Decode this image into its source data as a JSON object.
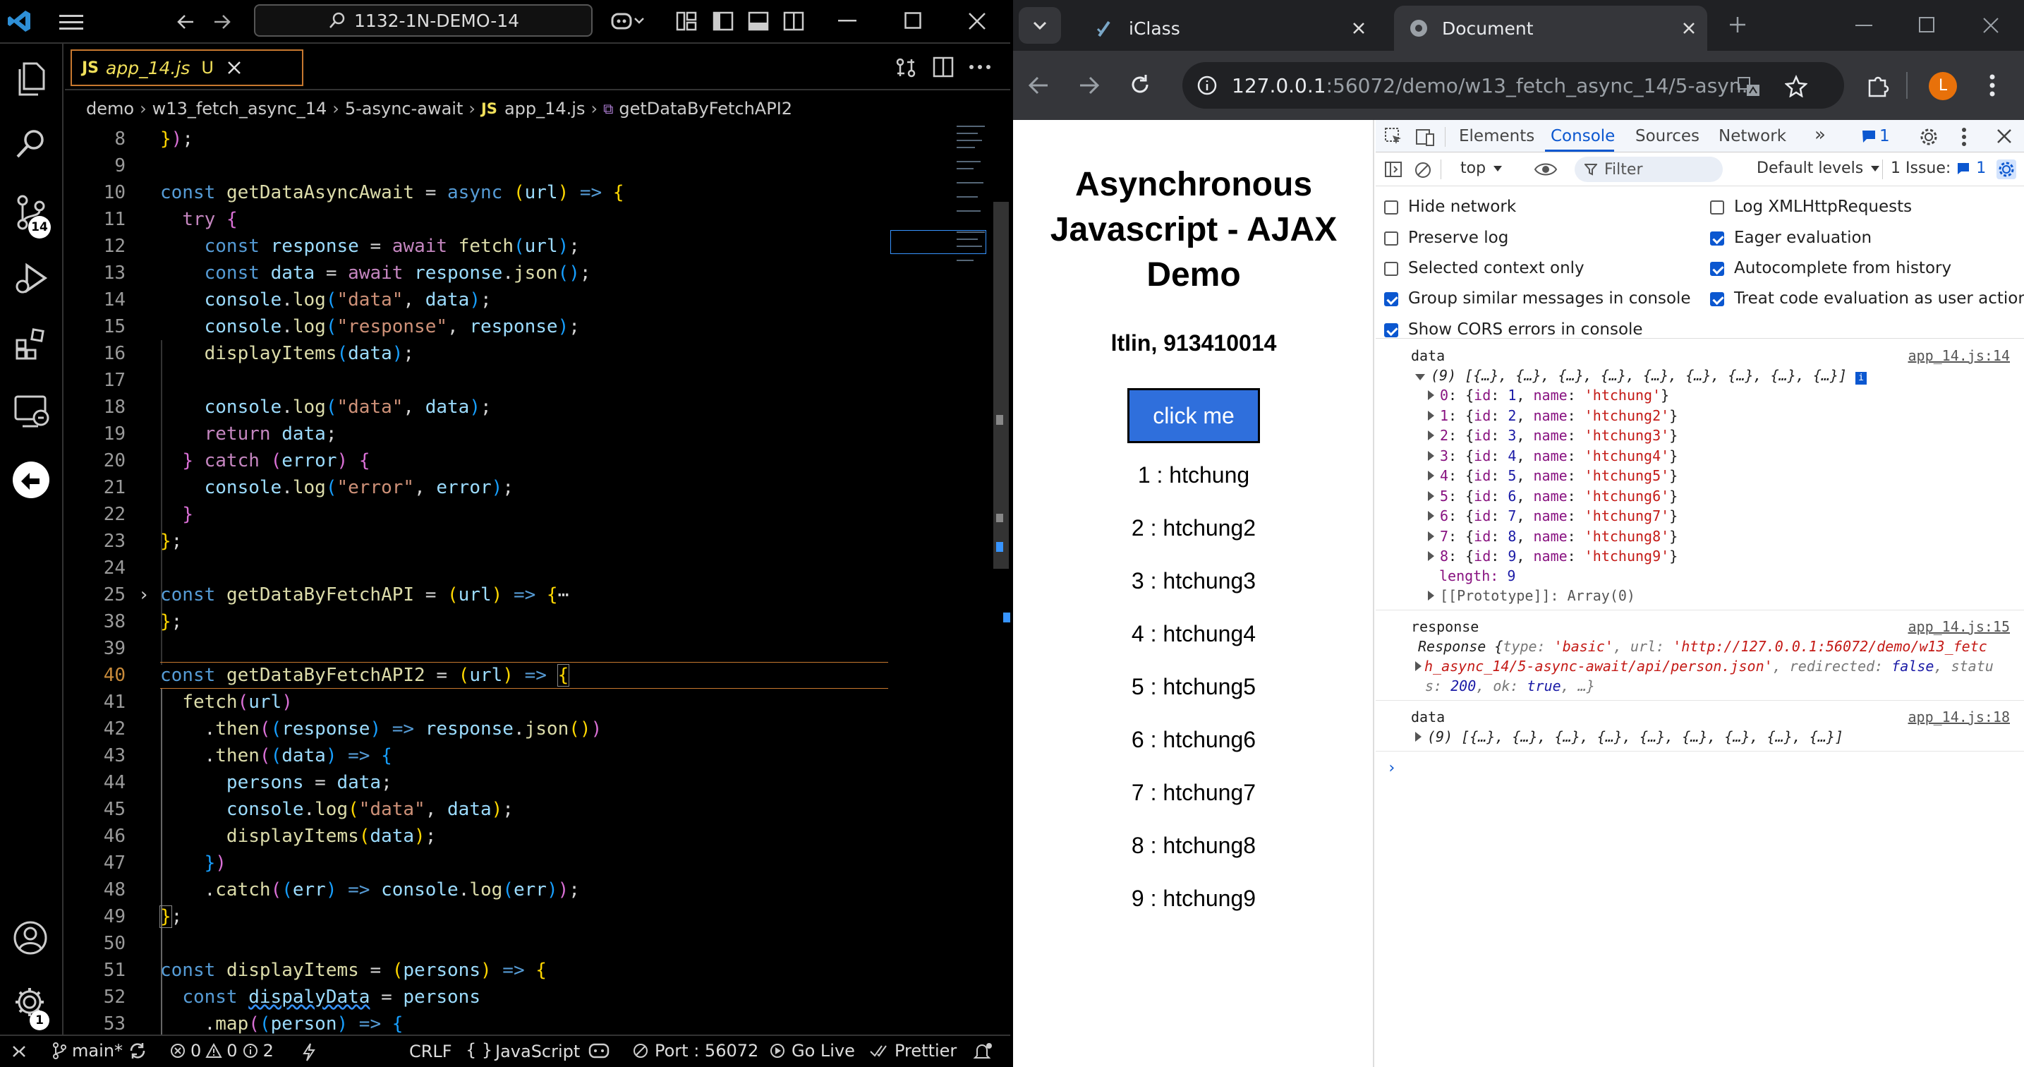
{
  "vscode": {
    "search_text": "1132-1N-DEMO-14",
    "tab": {
      "lang": "JS",
      "filename": "app_14.js",
      "status": "U"
    },
    "breadcrumb": [
      "demo",
      "w13_fetch_async_14",
      "5-async-await",
      "app_14.js",
      "getDataByFetchAPI2"
    ],
    "breadcrumb_js": "JS",
    "badge_scm": "14",
    "badge_settings": "1",
    "lines": [
      "8",
      "9",
      "10",
      "11",
      "12",
      "13",
      "14",
      "15",
      "16",
      "17",
      "18",
      "19",
      "20",
      "21",
      "22",
      "23",
      "24",
      "25",
      "38",
      "39",
      "40",
      "41",
      "42",
      "43",
      "44",
      "45",
      "46",
      "47",
      "48",
      "49",
      "50",
      "51",
      "52",
      "53"
    ],
    "status": {
      "branch": "main*",
      "errors": "0",
      "warnings": "0",
      "infos": "2",
      "eol": "CRLF",
      "lang": "JavaScript",
      "port": "Port : 56072",
      "golive": "Go Live",
      "prettier": "Prettier"
    }
  },
  "browser": {
    "tabs": [
      {
        "title": "iClass"
      },
      {
        "title": "Document"
      }
    ],
    "url_host": "127.0.0.1",
    "url_rest": ":56072/demo/w13_fetch_async_14/5-asyn...",
    "profile_initial": "L",
    "page": {
      "title": "Asynchronous Javascript - AJAX Demo",
      "subtitle": "ltlin, 913410014",
      "button": "click me",
      "items": [
        "1 : htchung",
        "2 : htchung2",
        "3 : htchung3",
        "4 : htchung4",
        "5 : htchung5",
        "6 : htchung6",
        "7 : htchung7",
        "8 : htchung8",
        "9 : htchung9"
      ]
    },
    "devtools": {
      "tabs": [
        "Elements",
        "Console",
        "Sources",
        "Network"
      ],
      "active_tab": "Console",
      "messages_count": "1",
      "context": "top",
      "filter_placeholder": "Filter",
      "levels": "Default levels",
      "issues_label": "1 Issue:",
      "issues_count": "1",
      "settings": [
        {
          "label": "Hide network",
          "checked": false
        },
        {
          "label": "Log XMLHttpRequests",
          "checked": false
        },
        {
          "label": "Preserve log",
          "checked": false
        },
        {
          "label": "Eager evaluation",
          "checked": true
        },
        {
          "label": "Selected context only",
          "checked": false
        },
        {
          "label": "Autocomplete from history",
          "checked": true
        },
        {
          "label": "Group similar messages in console",
          "checked": true
        },
        {
          "label": "Treat code evaluation as user action",
          "checked": true
        },
        {
          "label": "Show CORS errors in console",
          "checked": true
        }
      ],
      "log1": {
        "label": "data",
        "source": "app_14.js:14",
        "summary": "(9) [{…}, {…}, {…}, {…}, {…}, {…}, {…}, {…}, {…}]",
        "entries": [
          {
            "i": "0",
            "id": "1",
            "name": "'htchung'"
          },
          {
            "i": "1",
            "id": "2",
            "name": "'htchung2'"
          },
          {
            "i": "2",
            "id": "3",
            "name": "'htchung3'"
          },
          {
            "i": "3",
            "id": "4",
            "name": "'htchung4'"
          },
          {
            "i": "4",
            "id": "5",
            "name": "'htchung5'"
          },
          {
            "i": "5",
            "id": "6",
            "name": "'htchung6'"
          },
          {
            "i": "6",
            "id": "7",
            "name": "'htchung7'"
          },
          {
            "i": "7",
            "id": "8",
            "name": "'htchung8'"
          },
          {
            "i": "8",
            "id": "9",
            "name": "'htchung9'"
          }
        ],
        "length_label": "length:",
        "length": "9",
        "proto": "[[Prototype]]: Array(0)"
      },
      "log2": {
        "label": "response",
        "source": "app_14.js:15",
        "line1_a": "Response {",
        "line1_b": "type: ",
        "line1_c": "'basic'",
        "line1_d": ", url: ",
        "line1_e": "'http://127.0.0.1:56072/demo/w13_fetc",
        "line2_a": "h_async_14/5-async-await/api/person.json'",
        "line2_b": ", redirected: ",
        "line2_c": "false",
        "line2_d": ", statu",
        "line3_a": "s: ",
        "line3_b": "200",
        "line3_c": ", ok: ",
        "line3_d": "true",
        "line3_e": ", …}"
      },
      "log3": {
        "label": "data",
        "source": "app_14.js:18",
        "summary": "(9) [{…}, {…}, {…}, {…}, {…}, {…}, {…}, {…}, {…}]"
      }
    }
  }
}
